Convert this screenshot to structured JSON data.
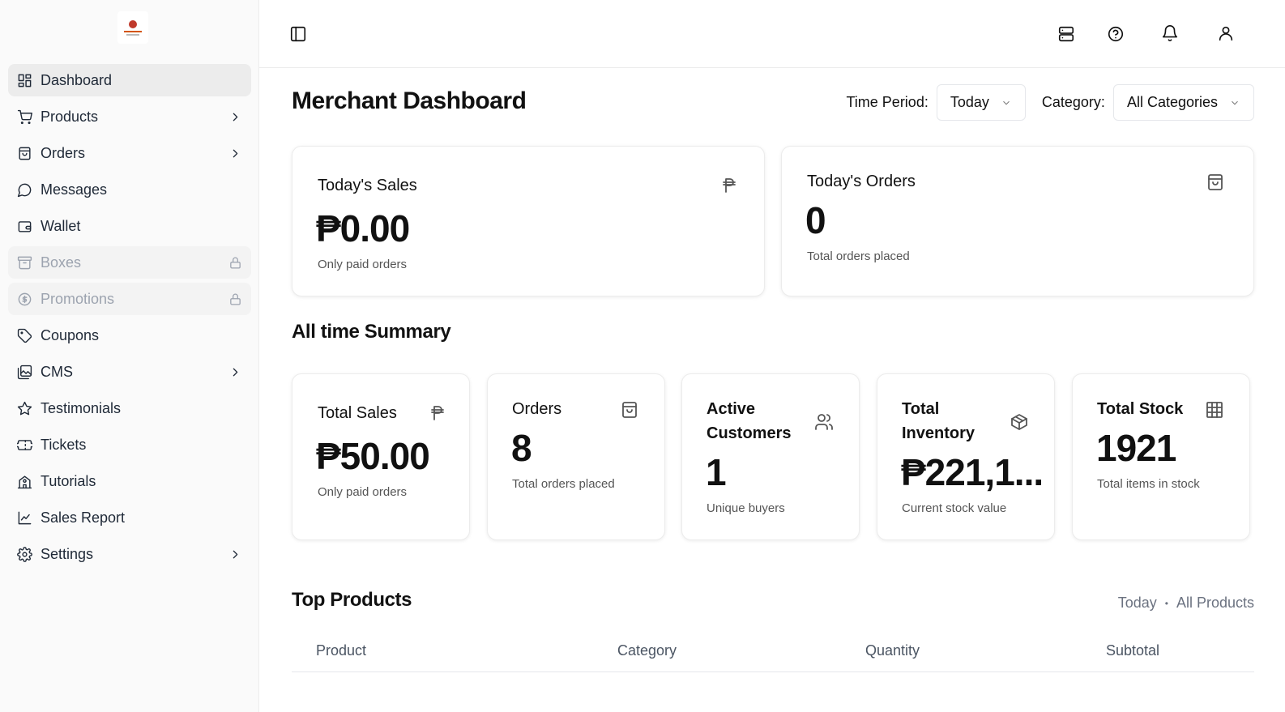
{
  "sidebar": {
    "items": [
      {
        "label": "Dashboard"
      },
      {
        "label": "Products"
      },
      {
        "label": "Orders"
      },
      {
        "label": "Messages"
      },
      {
        "label": "Wallet"
      },
      {
        "label": "Boxes"
      },
      {
        "label": "Promotions"
      },
      {
        "label": "Coupons"
      },
      {
        "label": "CMS"
      },
      {
        "label": "Testimonials"
      },
      {
        "label": "Tickets"
      },
      {
        "label": "Tutorials"
      },
      {
        "label": "Sales Report"
      },
      {
        "label": "Settings"
      }
    ]
  },
  "header": {
    "title": "Merchant Dashboard",
    "time_period_label": "Time Period:",
    "time_period_value": "Today",
    "category_label": "Category:",
    "category_value": "All Categories"
  },
  "today": {
    "sales": {
      "title": "Today's Sales",
      "value": "₱0.00",
      "sub": "Only paid orders"
    },
    "orders": {
      "title": "Today's Orders",
      "value": "0",
      "sub": "Total orders placed"
    }
  },
  "summary": {
    "title": "All time Summary",
    "total_sales": {
      "title": "Total Sales",
      "value": "₱50.00",
      "sub": "Only paid orders"
    },
    "orders": {
      "title": "Orders",
      "value": "8",
      "sub": "Total orders placed"
    },
    "customers": {
      "title_line1": "Active",
      "title_line2": "Customers",
      "value": "1",
      "sub": "Unique buyers"
    },
    "inventory": {
      "title_line1": "Total",
      "title_line2": "Inventory",
      "value": "₱221,1...",
      "sub": "Current stock value"
    },
    "stock": {
      "title": "Total Stock",
      "value": "1921",
      "sub": "Total items in stock"
    }
  },
  "top_products": {
    "title": "Top Products",
    "period": "Today",
    "scope": "All Products",
    "columns": [
      "Product",
      "Category",
      "Quantity",
      "Subtotal"
    ]
  }
}
